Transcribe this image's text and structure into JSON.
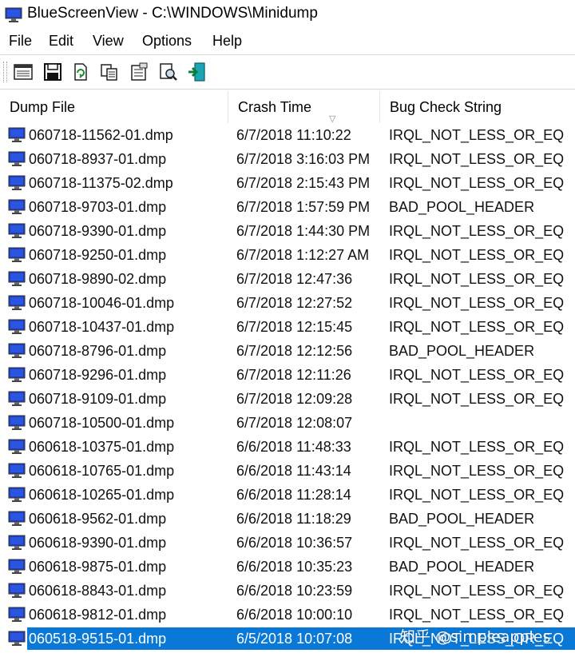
{
  "window": {
    "title": "BlueScreenView  -  C:\\WINDOWS\\Minidump"
  },
  "menu": {
    "items": [
      "File",
      "Edit",
      "View",
      "Options",
      "Help"
    ]
  },
  "toolbar": {
    "icons": [
      "properties-icon",
      "save-icon",
      "refresh-icon",
      "copy-icon",
      "html-report-icon",
      "find-icon",
      "exit-icon"
    ]
  },
  "columns": {
    "dump_file": "Dump File",
    "crash_time": "Crash Time",
    "bug_check": "Bug Check String"
  },
  "rows": [
    {
      "file": "060718-11562-01.dmp",
      "time": "6/7/2018 11:10:22",
      "bug": "IRQL_NOT_LESS_OR_EQ"
    },
    {
      "file": "060718-8937-01.dmp",
      "time": "6/7/2018 3:16:03 PM",
      "bug": "IRQL_NOT_LESS_OR_EQ"
    },
    {
      "file": "060718-11375-02.dmp",
      "time": "6/7/2018 2:15:43 PM",
      "bug": "IRQL_NOT_LESS_OR_EQ"
    },
    {
      "file": "060718-9703-01.dmp",
      "time": "6/7/2018 1:57:59 PM",
      "bug": "BAD_POOL_HEADER"
    },
    {
      "file": "060718-9390-01.dmp",
      "time": "6/7/2018 1:44:30 PM",
      "bug": "IRQL_NOT_LESS_OR_EQ"
    },
    {
      "file": "060718-9250-01.dmp",
      "time": "6/7/2018 1:12:27 AM",
      "bug": "IRQL_NOT_LESS_OR_EQ"
    },
    {
      "file": "060718-9890-02.dmp",
      "time": "6/7/2018 12:47:36",
      "bug": "IRQL_NOT_LESS_OR_EQ"
    },
    {
      "file": "060718-10046-01.dmp",
      "time": "6/7/2018 12:27:52",
      "bug": "IRQL_NOT_LESS_OR_EQ"
    },
    {
      "file": "060718-10437-01.dmp",
      "time": "6/7/2018 12:15:45",
      "bug": "IRQL_NOT_LESS_OR_EQ"
    },
    {
      "file": "060718-8796-01.dmp",
      "time": "6/7/2018 12:12:56",
      "bug": "BAD_POOL_HEADER"
    },
    {
      "file": "060718-9296-01.dmp",
      "time": "6/7/2018 12:11:26",
      "bug": "IRQL_NOT_LESS_OR_EQ"
    },
    {
      "file": "060718-9109-01.dmp",
      "time": "6/7/2018 12:09:28",
      "bug": "IRQL_NOT_LESS_OR_EQ"
    },
    {
      "file": "060718-10500-01.dmp",
      "time": "6/7/2018 12:08:07",
      "bug": ""
    },
    {
      "file": "060618-10375-01.dmp",
      "time": "6/6/2018 11:48:33",
      "bug": "IRQL_NOT_LESS_OR_EQ"
    },
    {
      "file": "060618-10765-01.dmp",
      "time": "6/6/2018 11:43:14",
      "bug": "IRQL_NOT_LESS_OR_EQ"
    },
    {
      "file": "060618-10265-01.dmp",
      "time": "6/6/2018 11:28:14",
      "bug": "IRQL_NOT_LESS_OR_EQ"
    },
    {
      "file": "060618-9562-01.dmp",
      "time": "6/6/2018 11:18:29",
      "bug": "BAD_POOL_HEADER"
    },
    {
      "file": "060618-9390-01.dmp",
      "time": "6/6/2018 10:36:57",
      "bug": "IRQL_NOT_LESS_OR_EQ"
    },
    {
      "file": "060618-9875-01.dmp",
      "time": "6/6/2018 10:35:23",
      "bug": "BAD_POOL_HEADER"
    },
    {
      "file": "060618-8843-01.dmp",
      "time": "6/6/2018 10:23:59",
      "bug": "IRQL_NOT_LESS_OR_EQ"
    },
    {
      "file": "060618-9812-01.dmp",
      "time": "6/6/2018 10:00:10",
      "bug": "IRQL_NOT_LESS_OR_EQ"
    },
    {
      "file": "060518-9515-01.dmp",
      "time": "6/5/2018 10:07:08",
      "bug": "IRQL_NOT_LESS_OR_EQ",
      "selected": true
    }
  ],
  "watermark": "知乎 @simpleapples",
  "colors": {
    "selection": "#0a78d7",
    "dump_icon": "#1f3fbf"
  }
}
